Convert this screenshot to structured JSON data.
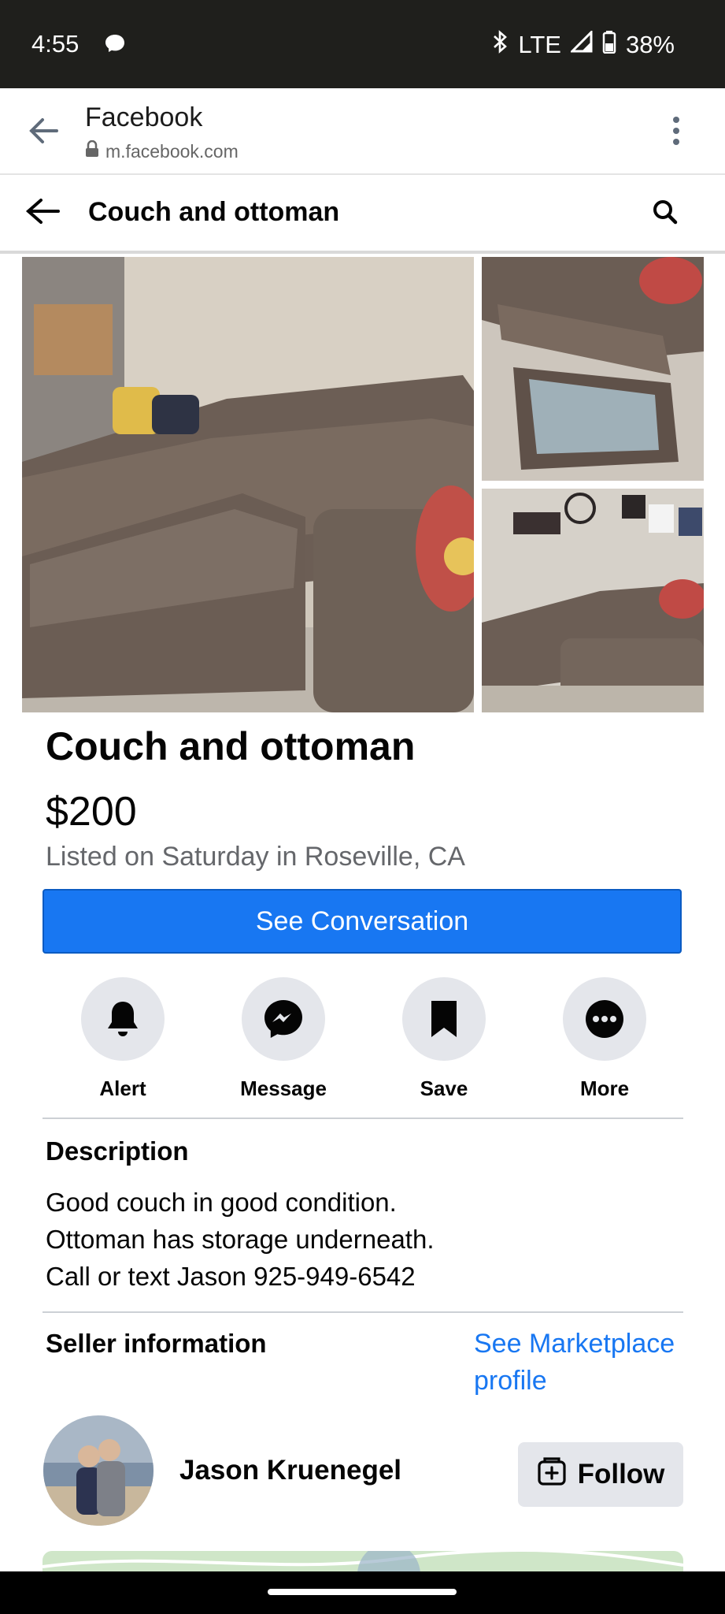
{
  "status_bar": {
    "time": "4:55",
    "network": "LTE",
    "battery": "38%"
  },
  "browser": {
    "title": "Facebook",
    "url": "m.facebook.com"
  },
  "header": {
    "title": "Couch and ottoman"
  },
  "listing": {
    "title": "Couch and ottoman",
    "price": "$200",
    "listed": "Listed on Saturday in Roseville, CA",
    "cta": "See Conversation"
  },
  "actions": [
    {
      "label": "Alert",
      "icon": "bell-icon"
    },
    {
      "label": "Message",
      "icon": "messenger-icon"
    },
    {
      "label": "Save",
      "icon": "bookmark-icon"
    },
    {
      "label": "More",
      "icon": "more-icon"
    }
  ],
  "description": {
    "heading": "Description",
    "text": "Good couch in good condition.\nOttoman has storage underneath.\nCall or text Jason 925-949-6542"
  },
  "seller": {
    "heading": "Seller information",
    "profile_link": "See Marketplace profile",
    "name": "Jason Kruenegel",
    "follow_label": "Follow"
  },
  "colors": {
    "accent": "#1877f2",
    "muted": "#65676b",
    "chip_bg": "#e4e6eb"
  }
}
